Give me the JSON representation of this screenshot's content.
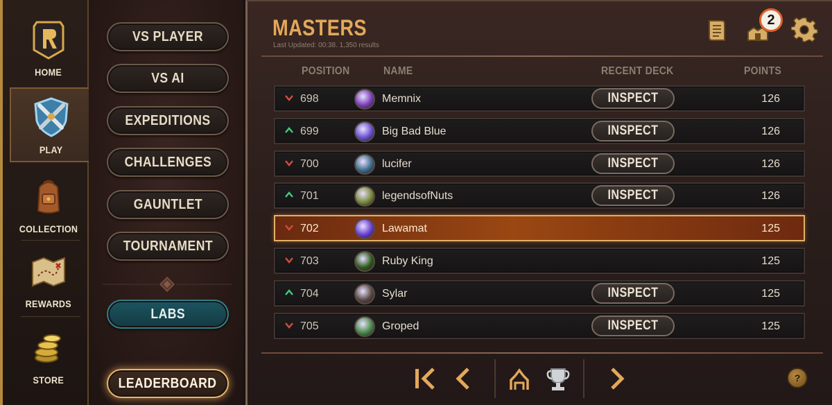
{
  "nav": {
    "items": [
      {
        "label": "HOME",
        "icon": "home-logo-icon"
      },
      {
        "label": "PLAY",
        "icon": "crossed-swords-icon",
        "active": true
      },
      {
        "label": "COLLECTION",
        "icon": "backpack-icon"
      },
      {
        "label": "REWARDS",
        "icon": "treasure-map-icon"
      },
      {
        "label": "STORE",
        "icon": "coins-icon"
      }
    ]
  },
  "modes": {
    "vs_player": "VS PLAYER",
    "vs_ai": "VS AI",
    "expeditions": "EXPEDITIONS",
    "challenges": "CHALLENGES",
    "gauntlet": "GAUNTLET",
    "tournament": "TOURNAMENT",
    "labs": "LABS",
    "leaderboard": "LEADERBOARD"
  },
  "leaderboard": {
    "title": "MASTERS",
    "updated": "Last Updated: 00:38. 1,350 results",
    "notification_count": "2",
    "headers": {
      "position": "POSITION",
      "name": "NAME",
      "recent_deck": "RECENT DECK",
      "points": "POINTS"
    },
    "inspect_label": "INSPECT",
    "rows": [
      {
        "trend": "down",
        "position": "698",
        "name": "Memnix",
        "points": "126",
        "inspect": true
      },
      {
        "trend": "up",
        "position": "699",
        "name": "Big Bad Blue",
        "points": "126",
        "inspect": true
      },
      {
        "trend": "down",
        "position": "700",
        "name": "lucifer",
        "points": "126",
        "inspect": true
      },
      {
        "trend": "up",
        "position": "701",
        "name": "legendsofNuts",
        "points": "126",
        "inspect": true
      },
      {
        "trend": "down",
        "position": "702",
        "name": "Lawamat",
        "points": "125",
        "inspect": false,
        "highlighted": true
      },
      {
        "trend": "down",
        "position": "703",
        "name": "Ruby King",
        "points": "125",
        "inspect": false
      },
      {
        "trend": "up",
        "position": "704",
        "name": "Sylar",
        "points": "125",
        "inspect": true
      },
      {
        "trend": "down",
        "position": "705",
        "name": "Groped",
        "points": "125",
        "inspect": true
      }
    ],
    "help_label": "?"
  },
  "colors": {
    "accent": "#e3a85a",
    "trend_up": "#3fc97a",
    "trend_down": "#d24a3f",
    "highlight": "#9a4712"
  }
}
